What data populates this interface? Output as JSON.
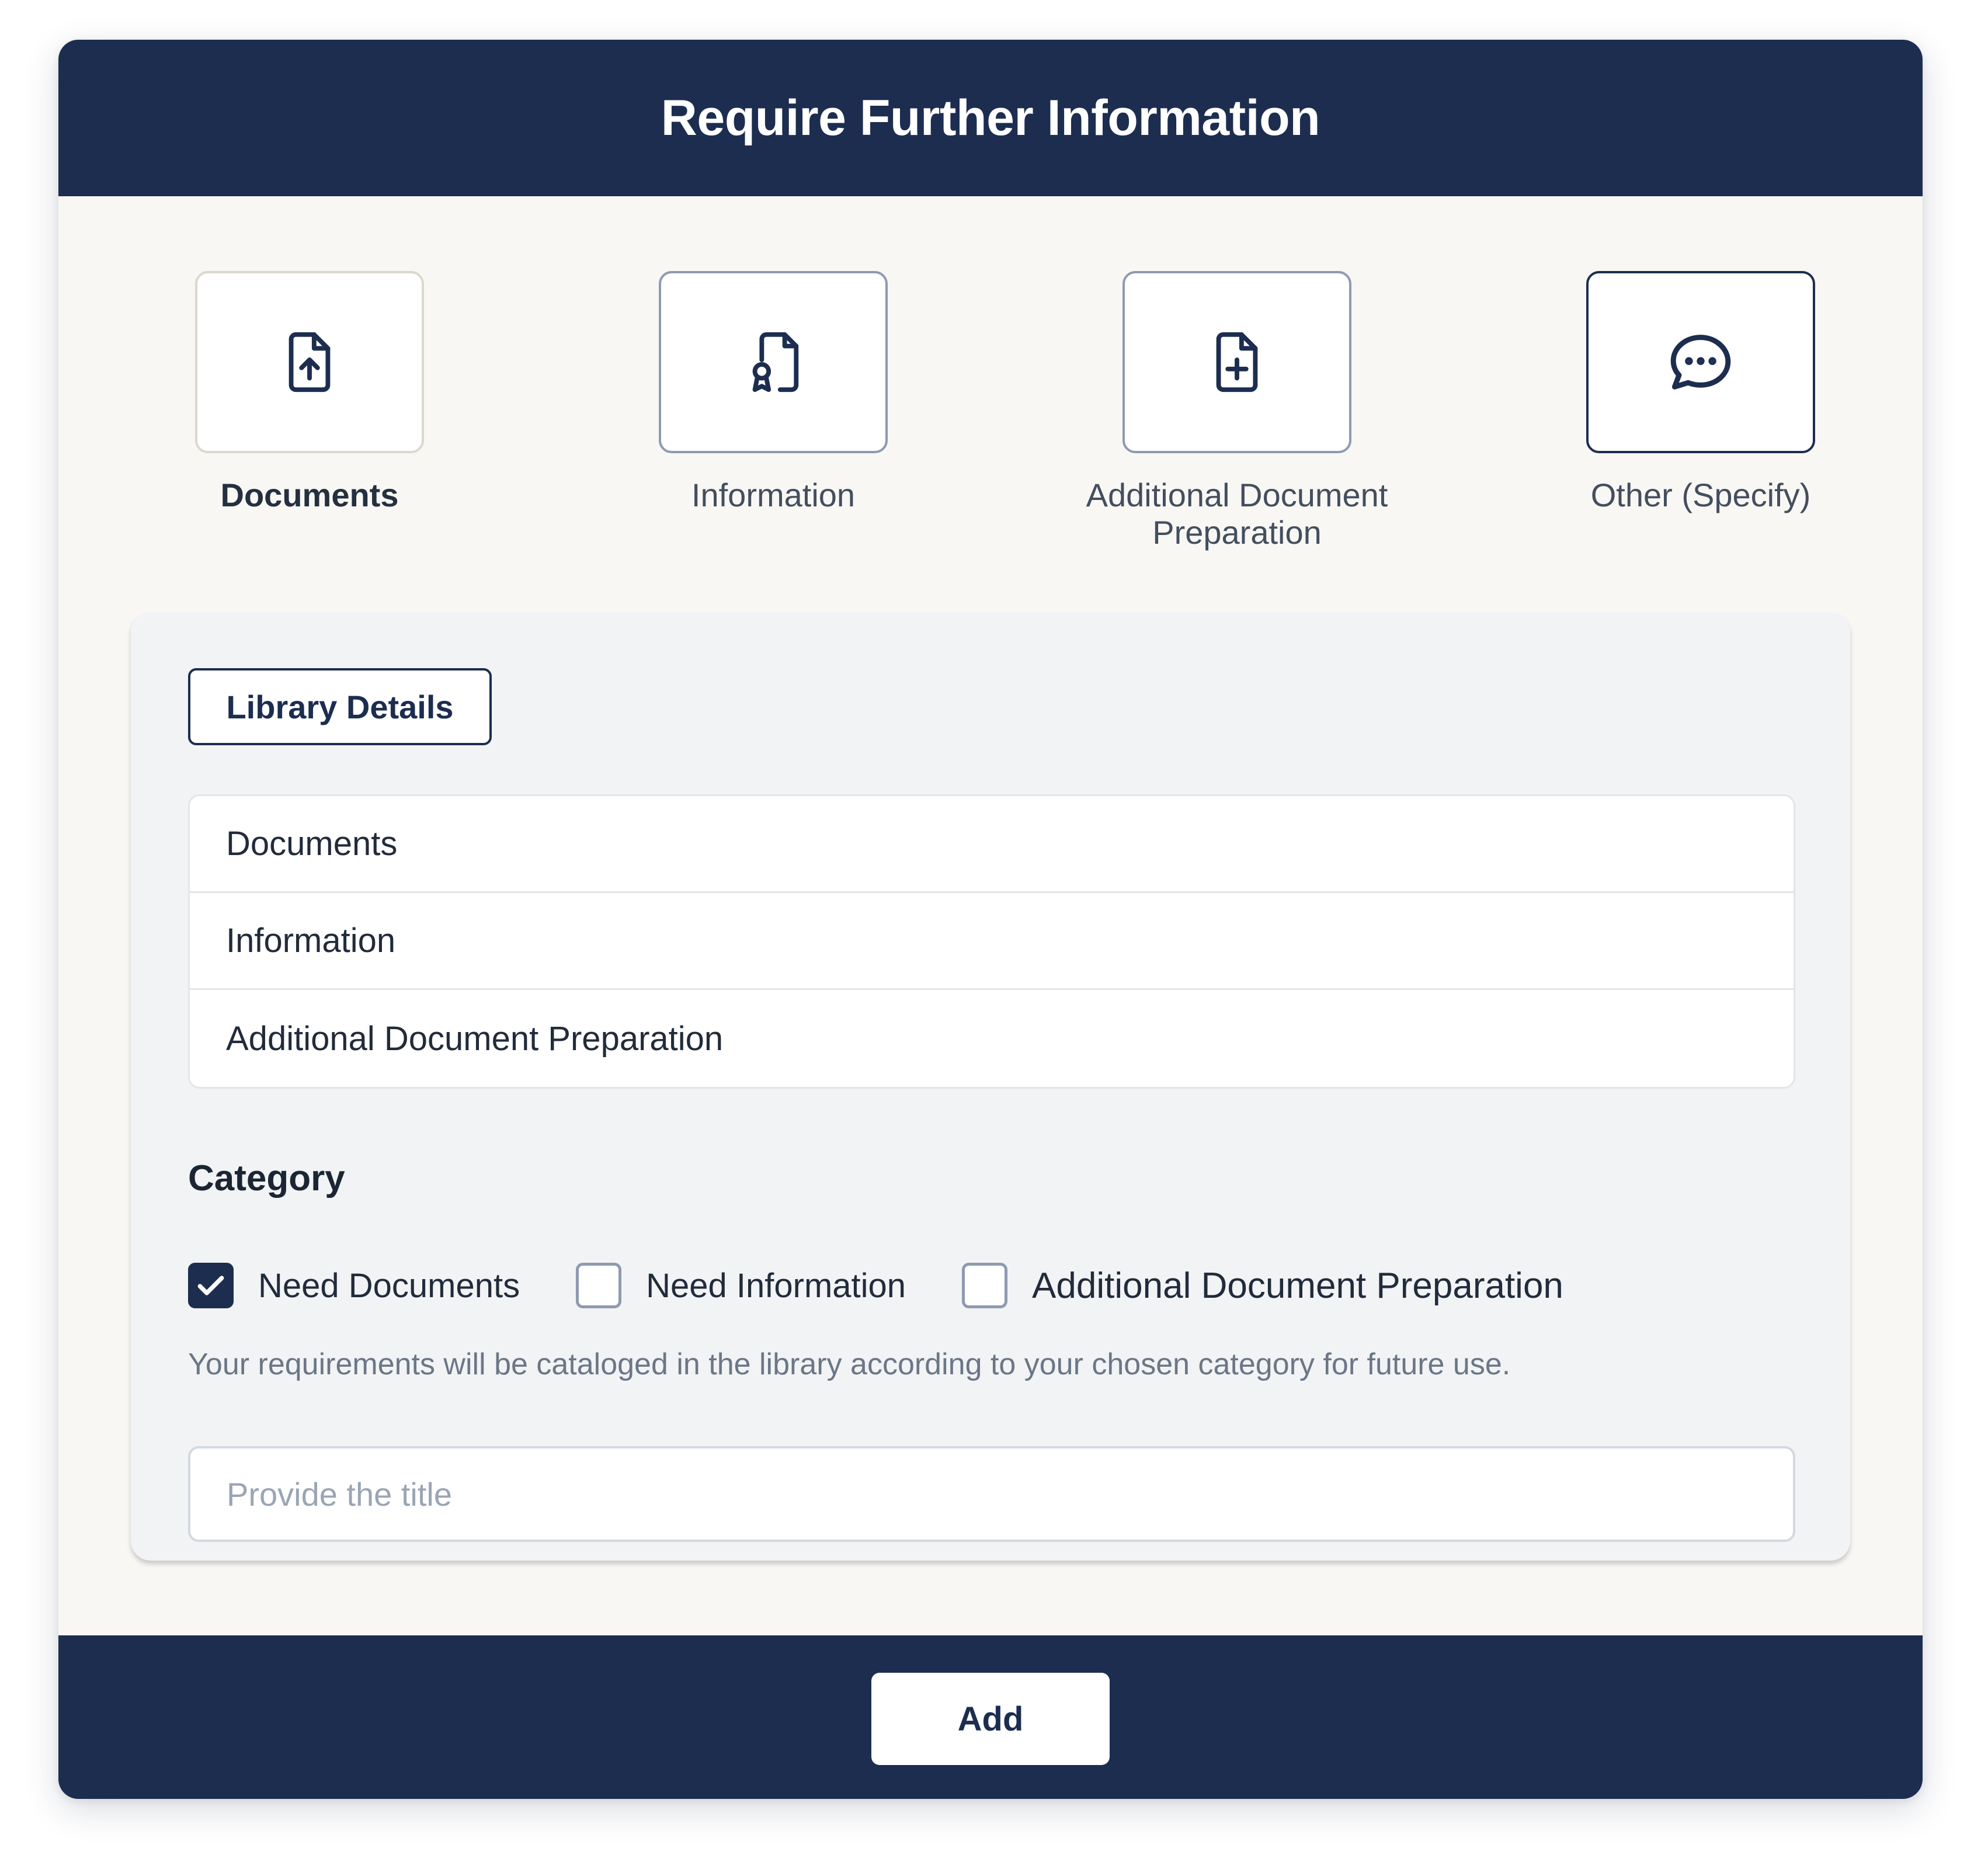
{
  "modal": {
    "title": "Require Further Information"
  },
  "request_types": [
    {
      "label": "Documents",
      "icon": "file-upload-icon",
      "selected": true
    },
    {
      "label": "Information",
      "icon": "file-certificate-icon",
      "selected": false
    },
    {
      "label": "Additional Document Preparation",
      "icon": "file-plus-icon",
      "selected": false
    },
    {
      "label": "Other (Specify)",
      "icon": "chat-bubble-icon",
      "selected": false
    }
  ],
  "library": {
    "button_label": "Library Details",
    "items": [
      {
        "label": "Documents"
      },
      {
        "label": "Information"
      },
      {
        "label": "Additional Document Preparation"
      }
    ]
  },
  "category": {
    "heading": "Category",
    "options": [
      {
        "label": "Need Documents",
        "checked": true
      },
      {
        "label": "Need Information",
        "checked": false
      },
      {
        "label": "Additional Document Preparation",
        "checked": false
      }
    ],
    "hint": "Your requirements will be cataloged in the library according to your chosen category for future use."
  },
  "title_input": {
    "placeholder": "Provide the title",
    "value": ""
  },
  "footer": {
    "add_label": "Add"
  },
  "colors": {
    "navy": "#1c2d50",
    "background": "#f8f7f4",
    "panel": "#f1f3f5"
  }
}
